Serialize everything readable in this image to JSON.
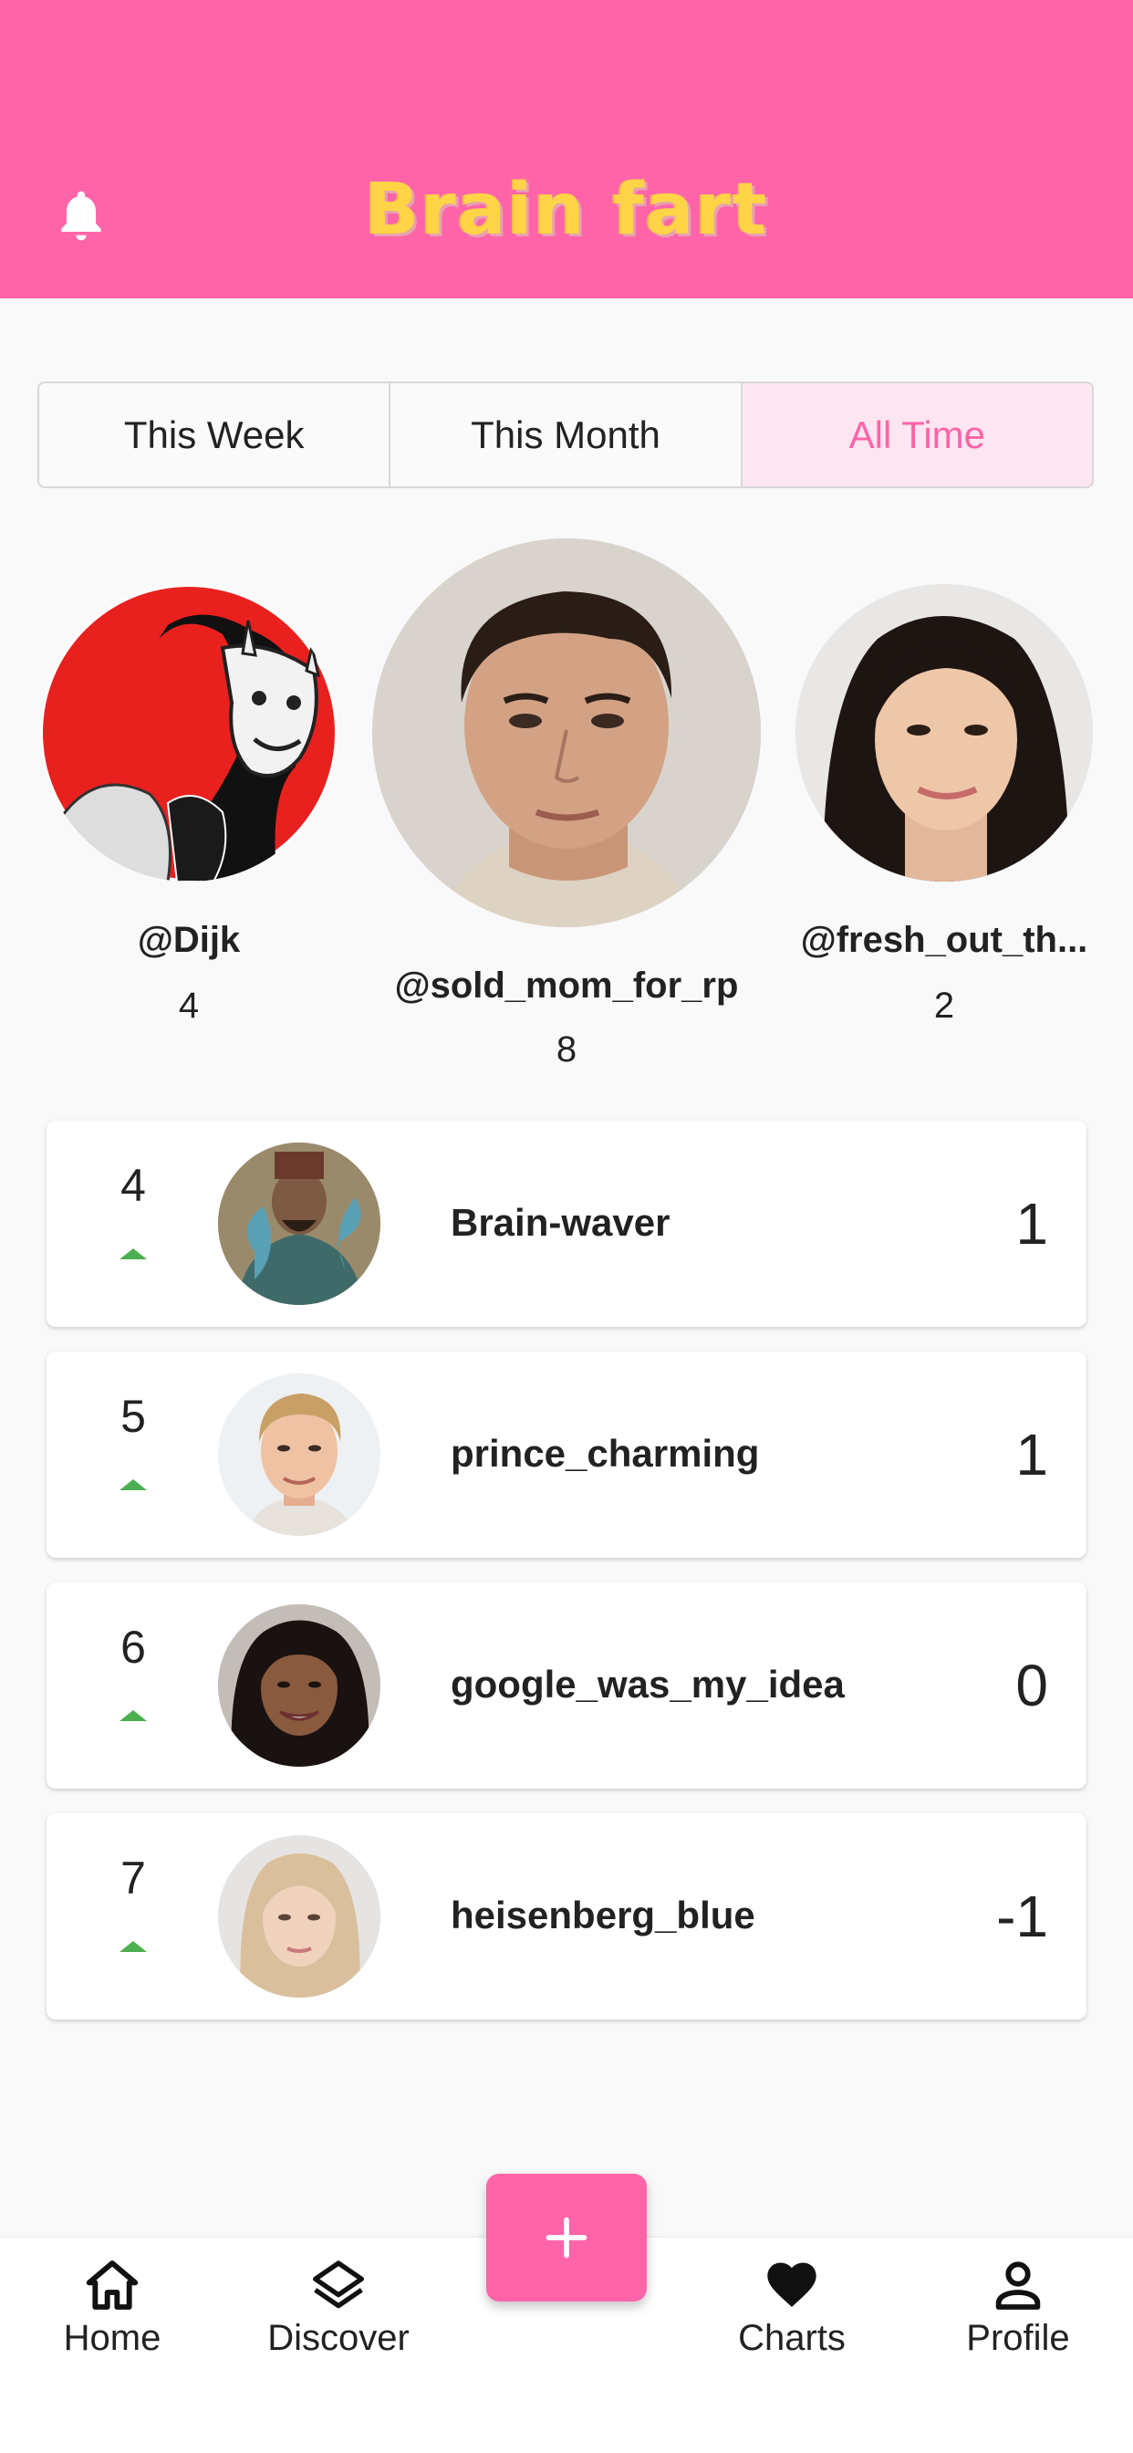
{
  "header": {
    "title": "Brain fart",
    "bell_icon": "bell-icon"
  },
  "tabs": [
    {
      "label": "This Week",
      "active": false
    },
    {
      "label": "This Month",
      "active": false
    },
    {
      "label": "All Time",
      "active": true
    }
  ],
  "podium": {
    "first": {
      "name": "@sold_mom_for_rp",
      "score": "8"
    },
    "second": {
      "name": "@Dijk",
      "score": "4"
    },
    "third": {
      "name": "@fresh_out_th...",
      "score": "2"
    }
  },
  "list": [
    {
      "rank": "4",
      "name": "Brain-waver",
      "score": "1",
      "trend": "up"
    },
    {
      "rank": "5",
      "name": "prince_charming",
      "score": "1",
      "trend": "up"
    },
    {
      "rank": "6",
      "name": "google_was_my_idea",
      "score": "0",
      "trend": "up"
    },
    {
      "rank": "7",
      "name": "heisenberg_blue",
      "score": "-1",
      "trend": "up"
    }
  ],
  "nav": {
    "home": "Home",
    "discover": "Discover",
    "charts": "Charts",
    "profile": "Profile"
  },
  "colors": {
    "accent": "#ff64a8",
    "title": "#ffd447",
    "trend_up": "#4caf50"
  }
}
